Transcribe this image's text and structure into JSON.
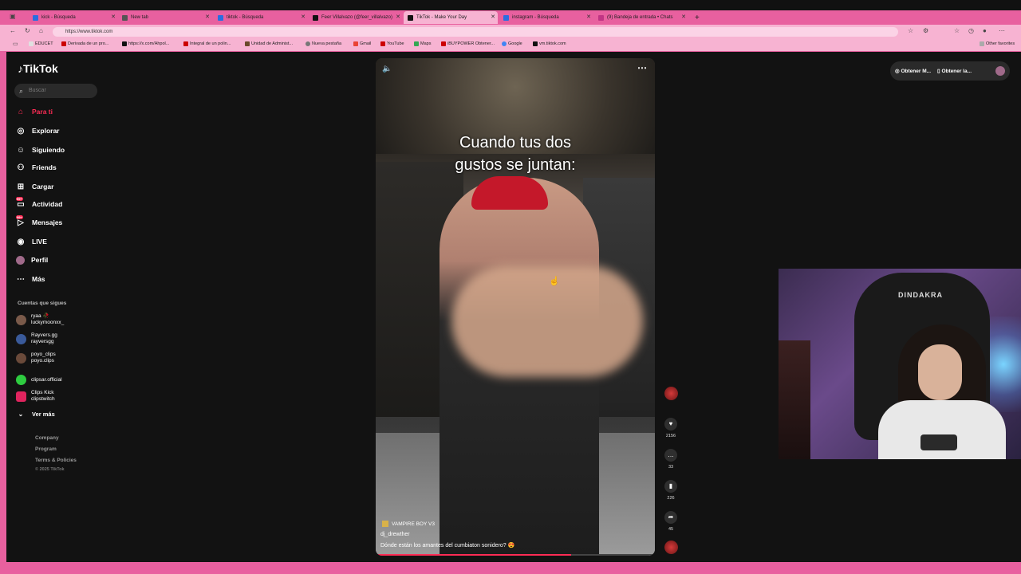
{
  "browser": {
    "tabs": [
      {
        "label": "kick - Búsqueda"
      },
      {
        "label": "New tab"
      },
      {
        "label": "tiktok - Búsqueda"
      },
      {
        "label": "Feer Villalvazo (@feer_villalvazo)"
      },
      {
        "label": "TikTok - Make Your Day"
      },
      {
        "label": "instagram - Búsqueda"
      },
      {
        "label": "(9) Bandeja de entrada • Chats"
      }
    ],
    "new_tab_label": "+",
    "url": "https://www.tiktok.com",
    "bookmarks": [
      {
        "label": "EDUCET"
      },
      {
        "label": "Derivada de un pro..."
      },
      {
        "label": "https://x.com/Ahpol..."
      },
      {
        "label": "Integral de un polin..."
      },
      {
        "label": "Unidad de Administ..."
      },
      {
        "label": "Nueva pestaña"
      },
      {
        "label": "Gmail"
      },
      {
        "label": "YouTube"
      },
      {
        "label": "Maps"
      },
      {
        "label": "iBUYPOWER Obtener..."
      },
      {
        "label": "Google"
      },
      {
        "label": "vm.tiktok.com"
      }
    ],
    "other_favorites": "Other favorites"
  },
  "sidebar": {
    "logo": "TikTok",
    "search_placeholder": "Buscar",
    "nav": [
      {
        "label": "Para ti",
        "icon": "home-icon"
      },
      {
        "label": "Explorar",
        "icon": "compass-icon"
      },
      {
        "label": "Siguiendo",
        "icon": "following-icon"
      },
      {
        "label": "Friends",
        "icon": "friends-icon"
      },
      {
        "label": "Cargar",
        "icon": "upload-icon"
      },
      {
        "label": "Actividad",
        "icon": "activity-icon"
      },
      {
        "label": "Mensajes",
        "icon": "messages-icon"
      },
      {
        "label": "LIVE",
        "icon": "live-icon"
      },
      {
        "label": "Perfil",
        "icon": "profile-icon"
      },
      {
        "label": "Más",
        "icon": "more-icon"
      }
    ],
    "badge": "99+",
    "following_title": "Cuentas que sigues",
    "following": [
      {
        "name": "ryaa 🥀",
        "handle": "luckymoonxx_"
      },
      {
        "name": "Rayvers.gg",
        "handle": "rayversgg"
      },
      {
        "name": "poyo_clips",
        "handle": "poyo.clips"
      },
      {
        "name": "clipsar.official",
        "handle": ""
      },
      {
        "name": "Clips Kick",
        "handle": "clipstwitch"
      }
    ],
    "see_more": "Ver más",
    "footer": [
      "Company",
      "Program",
      "Terms & Policies",
      "© 2025 TikTok"
    ]
  },
  "video": {
    "caption_line1": "Cuando tus dos",
    "caption_line2": "gustos se juntan:",
    "song": "VAMPIRE BOY V3",
    "username": "dj_drewther",
    "description": "Dónde están los amantes del cumbiaton sonidero? 😍",
    "progress": 0.7
  },
  "actions": {
    "likes": "2156",
    "comments": "33",
    "saves": "226",
    "shares": "45"
  },
  "topright": {
    "get_app_1": "Obtener M...",
    "get_app_2": "Obtener la..."
  },
  "webcam": {
    "chair_brand": "DINDAKRA"
  }
}
